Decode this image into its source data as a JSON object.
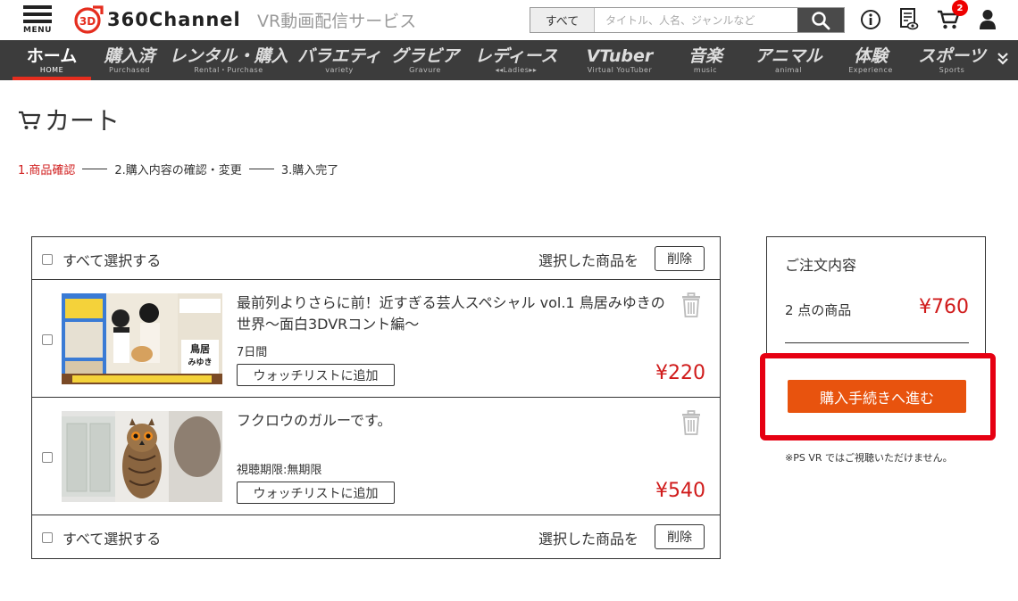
{
  "header": {
    "menu_label": "MENU",
    "logo_text": "360Channel",
    "tagline": "VR動画配信サービス",
    "search": {
      "scope": "すべて",
      "placeholder": "タイトル、人名、ジャンルなど"
    },
    "cart_count": "2"
  },
  "nav": {
    "items": [
      {
        "label": "ホーム",
        "sub": "HOME"
      },
      {
        "label": "購入済",
        "sub": "Purchased"
      },
      {
        "label": "レンタル・購入",
        "sub": "Rental・Purchase"
      },
      {
        "label": "バラエティ",
        "sub": "variety"
      },
      {
        "label": "グラビア",
        "sub": "Gravure"
      },
      {
        "label": "レディース",
        "sub": "◂◂Ladies▸▸"
      },
      {
        "label": "VTuber",
        "sub": "Virtual YouTuber"
      },
      {
        "label": "音楽",
        "sub": "music"
      },
      {
        "label": "アニマル",
        "sub": "animal"
      },
      {
        "label": "体験",
        "sub": "Experience"
      },
      {
        "label": "スポーツ",
        "sub": "Sports"
      }
    ]
  },
  "page": {
    "title": "カート",
    "steps": [
      "1.商品確認",
      "2.購入内容の確認・変更",
      "3.購入完了"
    ]
  },
  "cart": {
    "select_all": "すべて選択する",
    "selected_items": "選択した商品を",
    "delete": "削除",
    "items": [
      {
        "title": "最前列よりさらに前！近すぎる芸人スペシャル vol.1 鳥居みゆきの世界～面白3DVRコント編～",
        "period": "7日間",
        "watchlist": "ウォッチリストに追加",
        "price": "¥220"
      },
      {
        "title": "フクロウのガルーです。",
        "period": "視聴期限:無期限",
        "watchlist": "ウォッチリストに追加",
        "price": "¥540"
      }
    ]
  },
  "summary": {
    "title": "ご注文内容",
    "count": "2 点の商品",
    "total": "¥760",
    "checkout": "購入手続きへ進む",
    "notice": "※PS VR ではご視聴いただけません。"
  },
  "colors": {
    "accent_red": "#d01b1b",
    "checkout_orange": "#e8530e",
    "nav_bg": "#3c3c3c",
    "highlight_red": "#e60012"
  }
}
